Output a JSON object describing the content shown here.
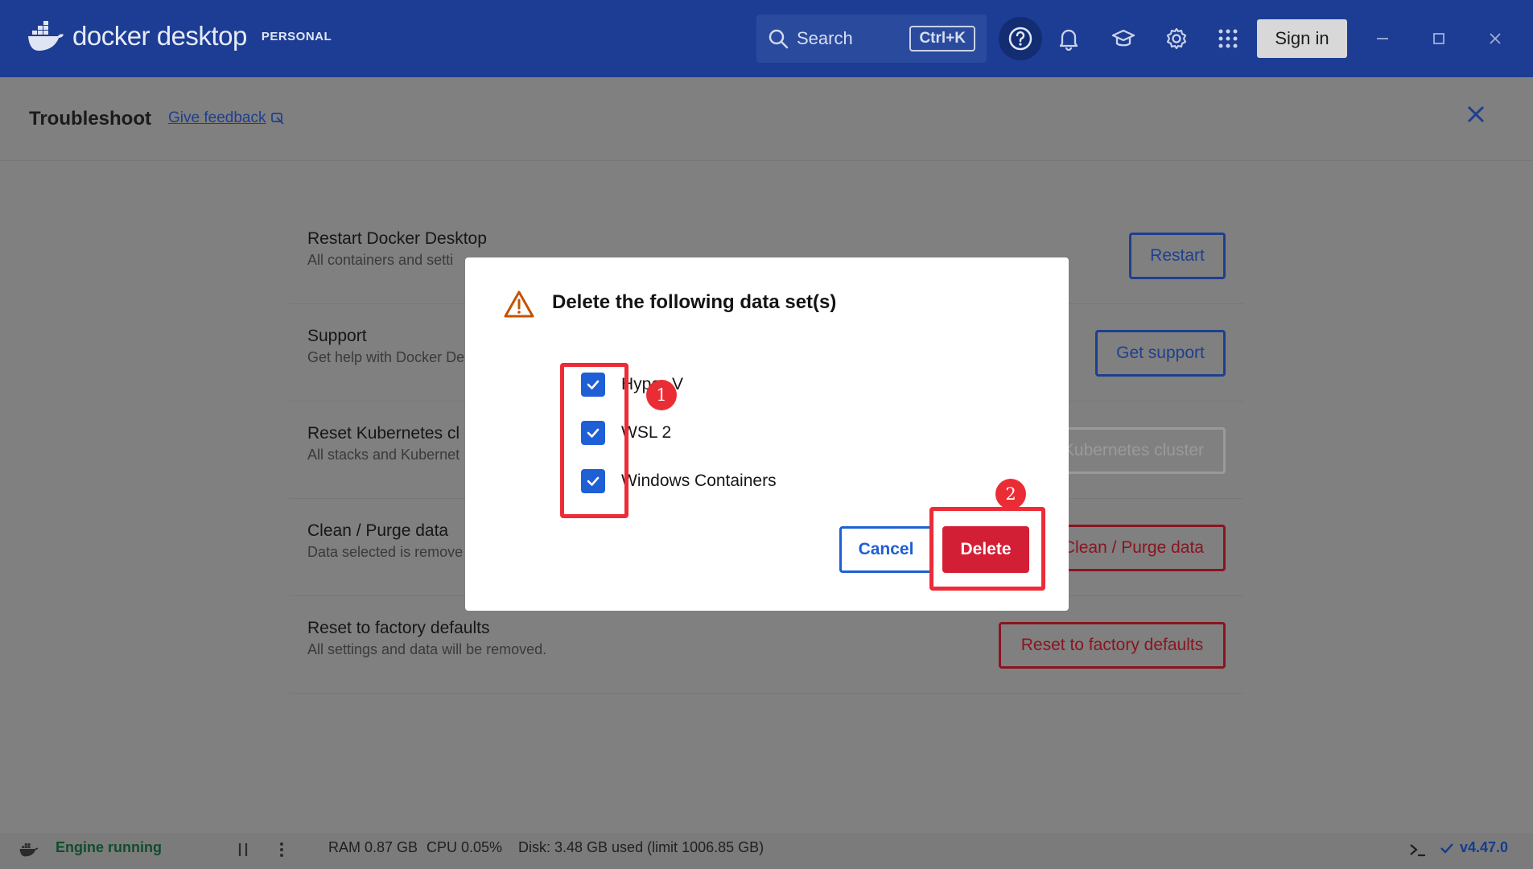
{
  "titlebar": {
    "brand": "docker desktop",
    "plan": "PERSONAL",
    "search_label": "Search",
    "search_shortcut": "Ctrl+K",
    "signin_label": "Sign in"
  },
  "header": {
    "title": "Troubleshoot",
    "feedback_label": "Give feedback"
  },
  "rows": [
    {
      "title": "Restart Docker Desktop",
      "desc": "All containers and setti",
      "button": "Restart"
    },
    {
      "title": "Support",
      "desc": "Get help with Docker De",
      "button": "Get support"
    },
    {
      "title": "Reset Kubernetes cl",
      "desc": "All stacks and Kubernet",
      "button": "Kubernetes cluster"
    },
    {
      "title": "Clean / Purge data",
      "desc": "Data selected is remove",
      "button": "Clean / Purge data"
    },
    {
      "title": "Reset to factory defaults",
      "desc": "All settings and data will be removed.",
      "button": "Reset to factory defaults"
    }
  ],
  "modal": {
    "title": "Delete the following data set(s)",
    "options": [
      {
        "label": "Hyper-V",
        "checked": true
      },
      {
        "label": "WSL 2",
        "checked": true
      },
      {
        "label": "Windows Containers",
        "checked": true
      }
    ],
    "cancel_label": "Cancel",
    "delete_label": "Delete"
  },
  "annotations": {
    "step1": "1",
    "step2": "2",
    "color": "#ee2b37"
  },
  "statusbar": {
    "engine": "Engine running",
    "ram": "RAM 0.87 GB",
    "cpu": "CPU 0.05%",
    "disk": "Disk: 3.48 GB used (limit 1006.85 GB)",
    "version": "v4.47.0"
  },
  "colors": {
    "titlebar": "#1d3d94",
    "accent": "#1e5fd6",
    "danger": "#d31f35"
  }
}
